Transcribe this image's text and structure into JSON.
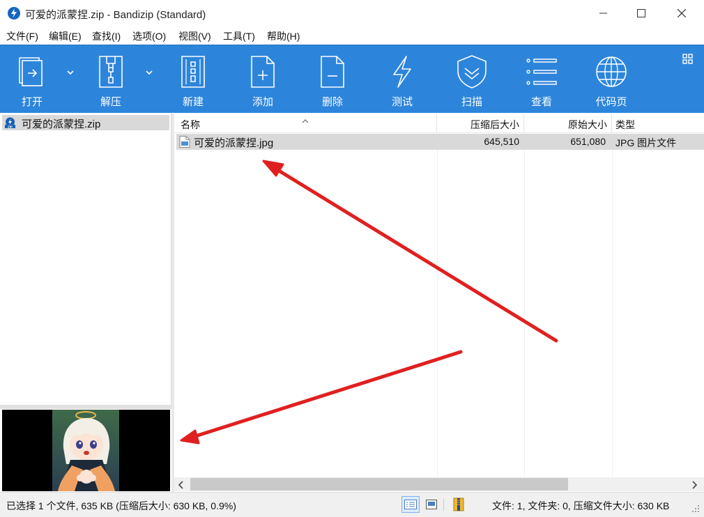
{
  "window": {
    "title": "可爱的派蒙捏.zip - Bandizip (Standard)"
  },
  "menu": [
    "文件(F)",
    "编辑(E)",
    "查找(I)",
    "选项(O)",
    "视图(V)",
    "工具(T)",
    "帮助(H)"
  ],
  "toolbar": {
    "open": "打开",
    "extract": "解压",
    "new": "新建",
    "add": "添加",
    "delete": "删除",
    "test": "测试",
    "scan": "扫描",
    "view": "查看",
    "codepage": "代码页"
  },
  "tree": {
    "archive": "可爱的派蒙捏.zip"
  },
  "columns": {
    "name": "名称",
    "packed": "压缩后大小",
    "original": "原始大小",
    "type": "类型"
  },
  "files": [
    {
      "name": "可爱的派蒙捏.jpg",
      "packed": "645,510",
      "original": "651,080",
      "type": "JPG 图片文件"
    }
  ],
  "status": {
    "selection": "已选择 1 个文件, 635 KB (压缩后大小: 630 KB, 0.9%)",
    "summary": "文件: 1, 文件夹: 0, 压缩文件大小: 630 KB"
  },
  "colors": {
    "toolbar": "#2d85db",
    "selection": "#d9d9d9",
    "annotation_arrow": "#e02020"
  }
}
